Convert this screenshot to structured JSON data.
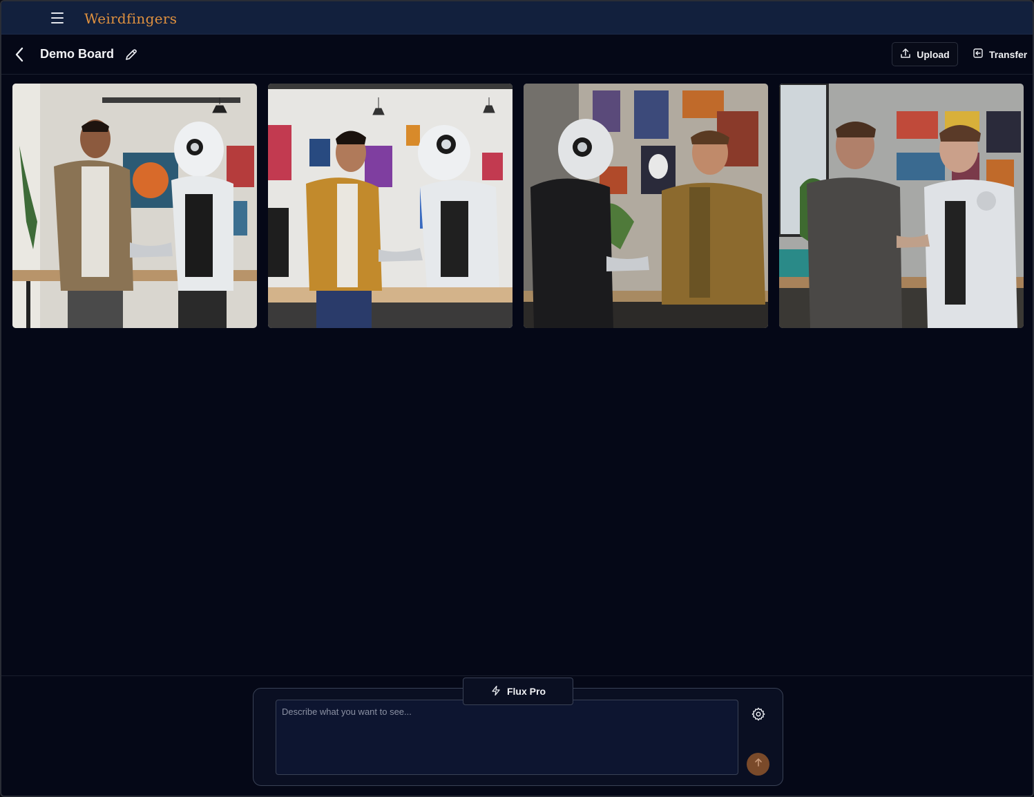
{
  "app": {
    "brand": "Weirdfingers"
  },
  "board": {
    "title": "Demo Board",
    "upload_label": "Upload",
    "transfer_label": "Transfer"
  },
  "gallery": {
    "images": [
      {
        "subject": "man in tan shirt shaking hands with white robot in art studio"
      },
      {
        "subject": "man in mustard jacket shaking hands with robot by desk"
      },
      {
        "subject": "robot in black hoodie shaking hands with man in brown jacket"
      },
      {
        "subject": "man in grey t-shirt shaking hands with silver android"
      }
    ]
  },
  "composer": {
    "model_label": "Flux Pro",
    "prompt_placeholder": "Describe what you want to see...",
    "prompt_value": ""
  },
  "icons": {
    "menu": "hamburger-icon",
    "back": "chevron-left-icon",
    "edit": "pencil-icon",
    "upload": "upload-icon",
    "transfer": "transfer-icon",
    "model": "lightning-icon",
    "settings": "gear-icon",
    "send": "arrow-up-icon"
  },
  "colors": {
    "brand": "#e0913f",
    "nav_bg": "#12203d",
    "page_bg": "#050817",
    "send_button": "#7a4a2a"
  }
}
